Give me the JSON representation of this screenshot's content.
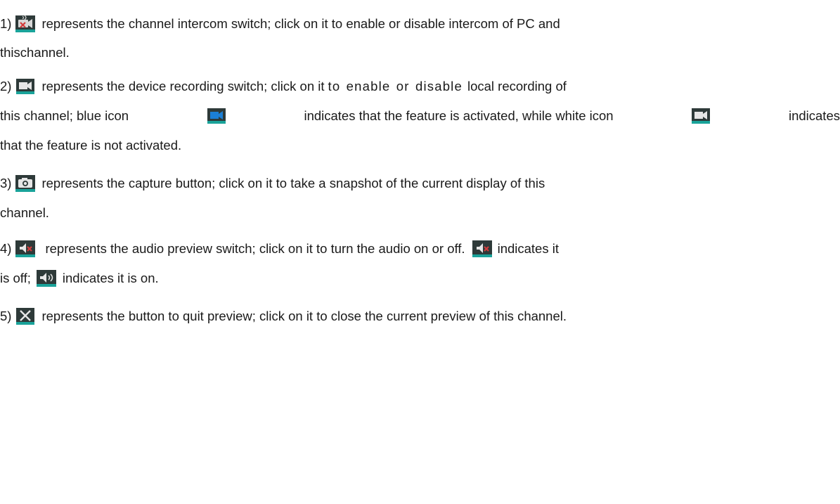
{
  "items": [
    {
      "num": "1)",
      "lines": [
        "represents the channel intercom switch; click on it to enable or disable intercom of PC and",
        "thischannel."
      ]
    },
    {
      "num": "2)",
      "line1_a": "represents the device recording switch; click on it",
      "line1_b": "to enable or disable",
      "line1_c": "local recording of",
      "line2_a": "this channel; blue icon",
      "line2_b": "indicates that the feature is activated, while white icon",
      "line2_c": "indicates",
      "line3": "that the feature is not activated."
    },
    {
      "num": "3)",
      "lines": [
        "represents the capture button; click on it to take a snapshot of the current display of this",
        "channel."
      ]
    },
    {
      "num": "4)",
      "line1_a": "represents the audio preview switch; click on it to turn the audio on or off.",
      "line1_b": "indicates it",
      "line2_a": "is off;",
      "line2_b": "indicates it is on."
    },
    {
      "num": "5)",
      "line1": "represents the button to quit preview; click on it to close the current preview of this channel."
    }
  ],
  "icons": {
    "intercom": "intercom-switch-icon",
    "record_white": "record-white-icon",
    "record_blue": "record-blue-icon",
    "capture": "camera-capture-icon",
    "audio_off": "audio-off-icon",
    "audio_on": "audio-on-icon",
    "close": "close-icon"
  },
  "colors": {
    "icon_bg": "#3a4a48",
    "icon_teal_bar": "#1aa39a",
    "record_blue": "#1b7fd6",
    "mute_red": "#d23b3b"
  }
}
